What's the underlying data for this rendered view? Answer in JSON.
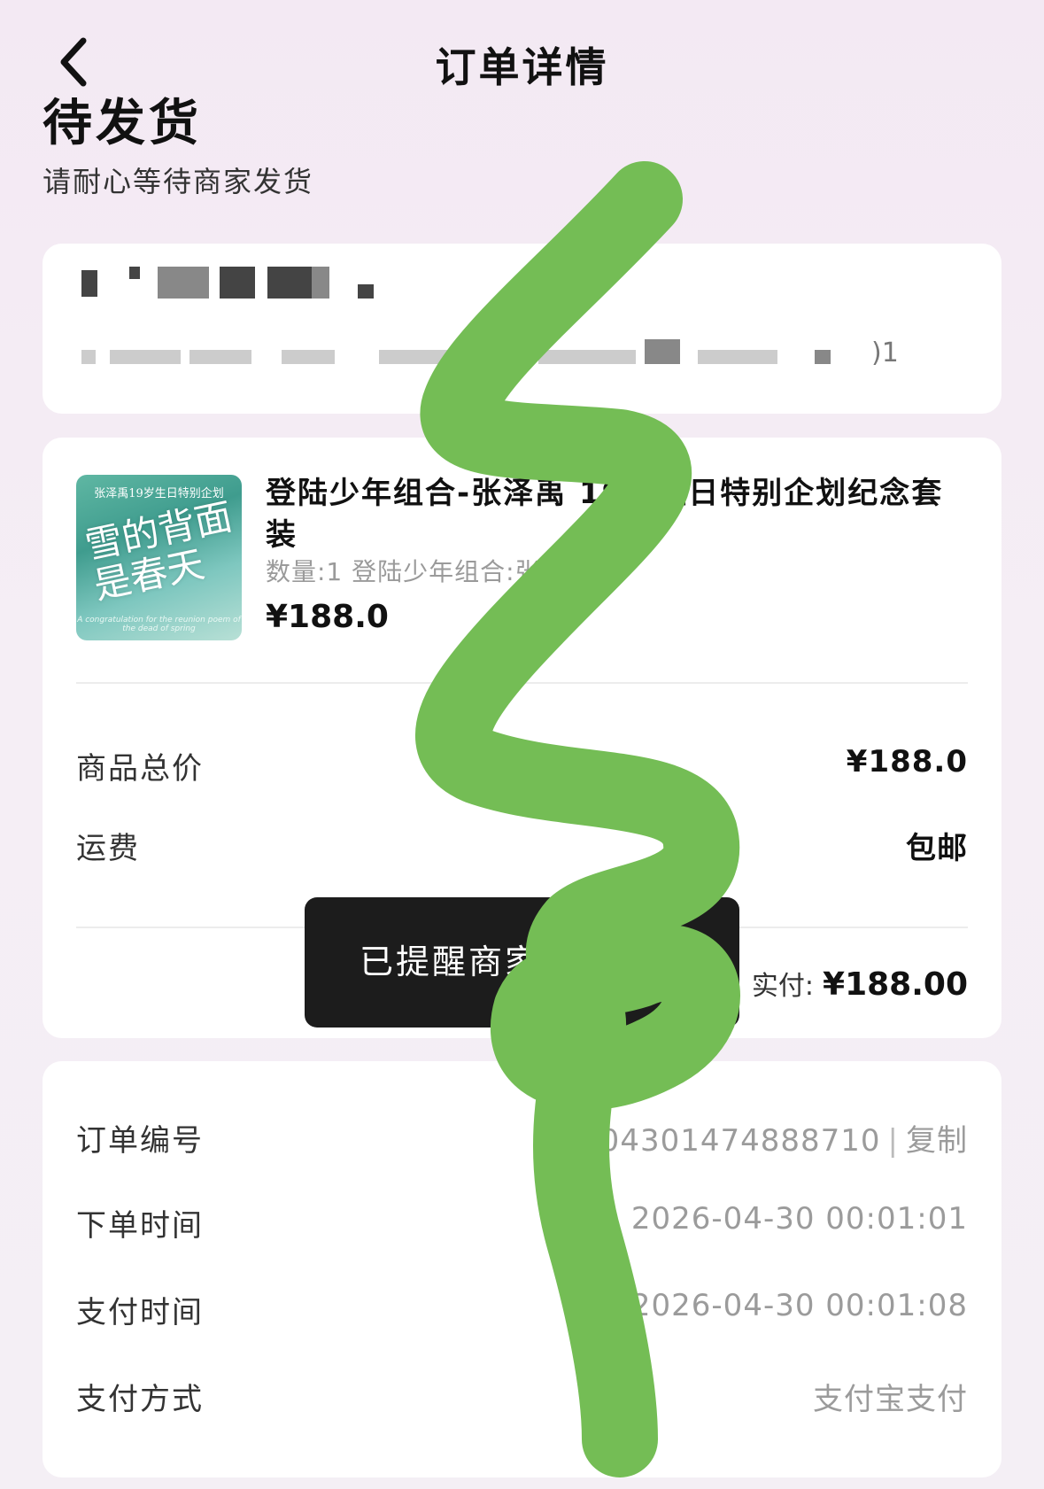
{
  "nav": {
    "title": "订单详情"
  },
  "status": {
    "title": "待发货",
    "subtitle": "请耐心等待商家发货"
  },
  "address": {
    "tail": ")1"
  },
  "goods": {
    "name": "登陆少年组合-张泽禹 19岁生日特别企划纪念套装",
    "spec": "数量:1 登陆少年组合:张泽禹",
    "price": "¥188.0",
    "thumb_caption": "张泽禹19岁生日特别企划",
    "thumb_art": "雪的背面是春天",
    "thumb_footer": "A congratulation for the reunion poem of the dead of spring"
  },
  "summary": {
    "goods_total_label": "商品总价",
    "goods_total_value": "¥188.0",
    "shipping_label": "运费",
    "shipping_value": "包邮",
    "paid_label": "实付:",
    "paid_value": "¥188.00"
  },
  "toast": {
    "text": "已提醒商家"
  },
  "order": {
    "number_label": "订单编号",
    "number_value": "2604301474888710",
    "copy_label": "复制",
    "order_time_label": "下单时间",
    "order_time_value": "2026-04-30 00:01:01",
    "pay_time_label": "支付时间",
    "pay_time_value": "2026-04-30 00:01:08",
    "pay_method_label": "支付方式",
    "pay_method_value": "支付宝支付"
  },
  "colors": {
    "scribble": "#74bd55",
    "toast_bg": "#1c1c1c"
  },
  "icons": {
    "back": "chevron-left-icon"
  }
}
